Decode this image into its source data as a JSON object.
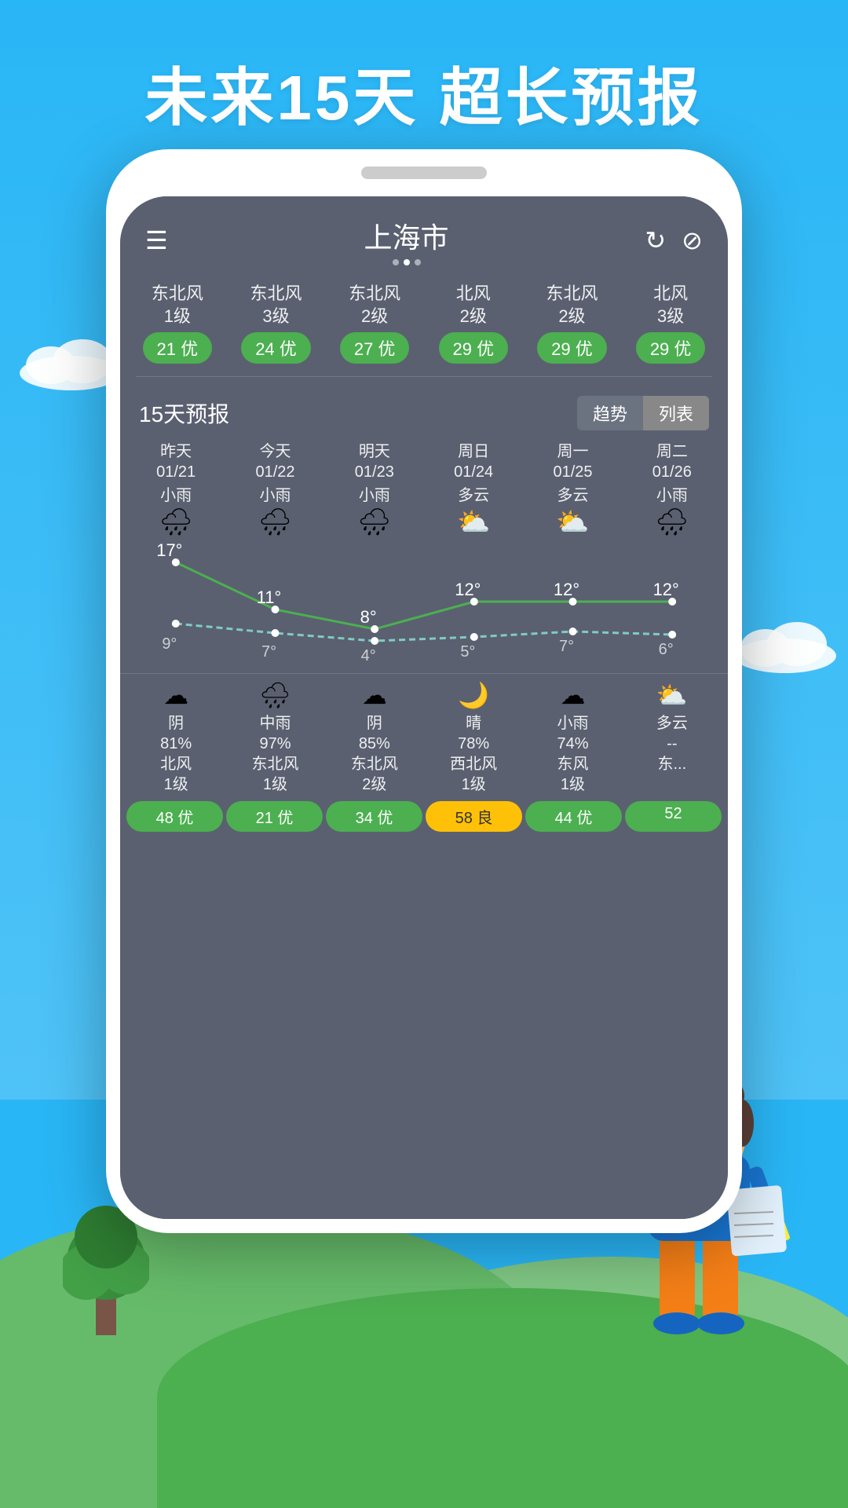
{
  "title": "未来15天  超长预报",
  "background": {
    "sky_color": "#29b6f6",
    "ground_color": "#4caf50"
  },
  "app": {
    "city": "上海市",
    "dots": [
      false,
      true,
      false
    ],
    "top_icons": [
      "refresh",
      "share"
    ],
    "aqi_items": [
      {
        "wind": "东北风\n1级",
        "badge": "21 优",
        "badge_type": "green"
      },
      {
        "wind": "东北风\n3级",
        "badge": "24 优",
        "badge_type": "green"
      },
      {
        "wind": "东北风\n2级",
        "badge": "27 优",
        "badge_type": "green"
      },
      {
        "wind": "北风\n2级",
        "badge": "29 优",
        "badge_type": "green"
      },
      {
        "wind": "东北风\n2级",
        "badge": "29 优",
        "badge_type": "green"
      },
      {
        "wind": "北风\n3级",
        "badge": "29 优",
        "badge_type": "green"
      }
    ],
    "forecast_title": "15天预报",
    "forecast_tabs": [
      "趋势",
      "列表"
    ],
    "days": [
      {
        "label": "昨天\n01/21",
        "weather": "小雨",
        "icon": "🌧",
        "high": "17°",
        "low": "9°"
      },
      {
        "label": "今天\n01/22",
        "weather": "小雨",
        "icon": "🌧",
        "high": "11°",
        "low": "7°"
      },
      {
        "label": "明天\n01/23",
        "weather": "小雨",
        "icon": "🌧",
        "high": "8°",
        "low": "4°"
      },
      {
        "label": "周日\n01/24",
        "weather": "多云",
        "icon": "⛅",
        "high": "12°",
        "low": "5°"
      },
      {
        "label": "周一\n01/25",
        "weather": "多云",
        "icon": "⛅",
        "high": "12°",
        "low": "7°"
      },
      {
        "label": "周二\n01/26",
        "weather": "小雨",
        "icon": "🌧",
        "high": "12°",
        "low": "6°"
      }
    ],
    "bottom_days": [
      {
        "icon": "☁",
        "text": "阴\n81%\n北风\n1级",
        "aqi": "48 优",
        "aqi_type": "green"
      },
      {
        "icon": "🌧",
        "text": "中雨\n97%\n东北风\n1级",
        "aqi": "21 优",
        "aqi_type": "green"
      },
      {
        "icon": "☁",
        "text": "阴\n85%\n东北风\n2级",
        "aqi": "34 优",
        "aqi_type": "green"
      },
      {
        "icon": "🌙",
        "text": "晴\n78%\n西北风\n1级",
        "aqi": "58 良",
        "aqi_type": "yellow"
      },
      {
        "icon": "☁",
        "text": "小雨\n74%\n东风\n1级",
        "aqi": "44 优",
        "aqi_type": "green"
      },
      {
        "icon": "⛅",
        "text": "多云\n--\n东...",
        "aqi": "52",
        "aqi_type": "green"
      }
    ]
  }
}
